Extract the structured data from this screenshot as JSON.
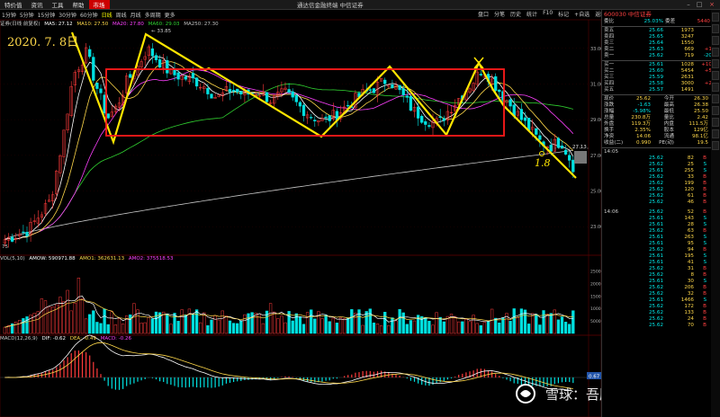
{
  "menubar": {
    "items": [
      "特价值",
      "资讯",
      "工具",
      "帮助",
      "市场"
    ],
    "title": "通达信金融终端 中信证券"
  },
  "toolbar": {
    "periods": [
      "1分钟",
      "5分钟",
      "15分钟",
      "30分钟",
      "60分钟",
      "日线",
      "周线",
      "月线",
      "多周期",
      "更多"
    ],
    "selected": "日线",
    "right": [
      "盘口",
      "分笔",
      "历史",
      "统计",
      "F10",
      "标记",
      "+自选",
      "返回"
    ]
  },
  "ma_legend": {
    "label": "证券(日线 前复权)",
    "items": [
      {
        "text": "MA5: 27.12",
        "color": "#ffffff"
      },
      {
        "text": "MA10: 27.50",
        "color": "#ffd84a"
      },
      {
        "text": "MA20: 27.80",
        "color": "#ff40ff"
      },
      {
        "text": "MA60: 29.03",
        "color": "#30d030"
      },
      {
        "text": "MA250: 27.30",
        "color": "#c0c0c0"
      }
    ]
  },
  "annotation": {
    "date": "2020. 7. 8日",
    "mark": "1.8"
  },
  "price_axis": {
    "labels": [
      "33.00",
      "31.00",
      "29.00",
      "27.00",
      "25.00",
      "23.00"
    ],
    "high_label": "33.85",
    "low_label": "75",
    "current_label": "27.13"
  },
  "volume_legend": {
    "label": "VOL(5,10)",
    "items": [
      {
        "text": "AMOW: 590971.88",
        "color": "#ffffff"
      },
      {
        "text": "AMO1: 362631.13",
        "color": "#ffd84a"
      },
      {
        "text": "AMO2: 375518.53",
        "color": "#ff40ff"
      }
    ],
    "axis": [
      "25000",
      "20000",
      "15000",
      "10000",
      "5000"
    ]
  },
  "macd_legend": {
    "label": "MACD(12,26,9)",
    "items": [
      {
        "text": "DIF: -0.62",
        "color": "#ffffff"
      },
      {
        "text": "DEA: -0.49",
        "color": "#ffd84a"
      },
      {
        "text": "MACD: -0.26",
        "color": "#ff40ff"
      }
    ],
    "value_box": "0.67"
  },
  "watermark": "雪球：吾股能手V",
  "panel": {
    "code": "600030",
    "name": "中信证券",
    "weibi": {
      "label": "委比",
      "value": "25.03%",
      "label2": "委差",
      "value2": "5440"
    },
    "asks": [
      {
        "label": "卖五",
        "price": "25.66",
        "vol": "1973",
        "chg": ""
      },
      {
        "label": "卖四",
        "price": "25.65",
        "vol": "3247",
        "chg": ""
      },
      {
        "label": "卖三",
        "price": "25.64",
        "vol": "1550",
        "chg": ""
      },
      {
        "label": "卖二",
        "price": "25.63",
        "vol": "669",
        "chg": "+1"
      },
      {
        "label": "卖一",
        "price": "25.62",
        "vol": "719",
        "chg": "-20"
      }
    ],
    "bids": [
      {
        "label": "买一",
        "price": "25.61",
        "vol": "1028",
        "chg": "+10"
      },
      {
        "label": "买二",
        "price": "25.60",
        "vol": "5454",
        "chg": "+5"
      },
      {
        "label": "买三",
        "price": "25.59",
        "vol": "2631",
        "chg": ""
      },
      {
        "label": "买四",
        "price": "25.58",
        "vol": "3000",
        "chg": "+2"
      },
      {
        "label": "买五",
        "price": "25.57",
        "vol": "1491",
        "chg": ""
      }
    ],
    "quote": [
      {
        "l1": "现价",
        "v1": "25.62",
        "l2": "今开",
        "v2": "26.30"
      },
      {
        "l1": "涨跌",
        "v1": "-1.63",
        "l2": "最高",
        "v2": "26.38"
      },
      {
        "l1": "涨幅",
        "v1": "-5.98%",
        "l2": "最低",
        "v2": "25.50"
      },
      {
        "l1": "总量",
        "v1": "230.8万",
        "l2": "量比",
        "v2": "2.42"
      },
      {
        "l1": "外盘",
        "v1": "119.3万",
        "l2": "内盘",
        "v2": "111.5万"
      },
      {
        "l1": "换手",
        "v1": "2.35%",
        "l2": "股本",
        "v2": "129亿"
      },
      {
        "l1": "净资",
        "v1": "14.06",
        "l2": "流通",
        "v2": "98.1亿"
      },
      {
        "l1": "收益(二)",
        "v1": "0.990",
        "l2": "PE(动)",
        "v2": "19.5"
      }
    ],
    "ticks1": [
      {
        "t": "14:05",
        "p": "",
        "v": "",
        "s": ""
      },
      {
        "t": "",
        "p": "25.62",
        "v": "82",
        "s": "B"
      },
      {
        "t": "",
        "p": "25.62",
        "v": "25",
        "s": "S"
      },
      {
        "t": "",
        "p": "25.61",
        "v": "255",
        "s": "S"
      },
      {
        "t": "",
        "p": "25.62",
        "v": "33",
        "s": "B"
      },
      {
        "t": "",
        "p": "25.62",
        "v": "199",
        "s": "B"
      },
      {
        "t": "",
        "p": "25.62",
        "v": "120",
        "s": "B"
      },
      {
        "t": "",
        "p": "25.62",
        "v": "61",
        "s": "B"
      },
      {
        "t": "",
        "p": "25.62",
        "v": "46",
        "s": "B"
      }
    ],
    "ticks2": [
      {
        "t": "14:06",
        "p": "25.62",
        "v": "52",
        "s": "B"
      },
      {
        "t": "",
        "p": "25.61",
        "v": "143",
        "s": "S"
      },
      {
        "t": "",
        "p": "25.61",
        "v": "28",
        "s": "S"
      },
      {
        "t": "",
        "p": "25.62",
        "v": "63",
        "s": "B"
      },
      {
        "t": "",
        "p": "25.61",
        "v": "263",
        "s": "S"
      },
      {
        "t": "",
        "p": "25.61",
        "v": "95",
        "s": "S"
      },
      {
        "t": "",
        "p": "25.62",
        "v": "94",
        "s": "B"
      },
      {
        "t": "",
        "p": "25.61",
        "v": "195",
        "s": "S"
      },
      {
        "t": "",
        "p": "25.61",
        "v": "41",
        "s": "S"
      },
      {
        "t": "",
        "p": "25.62",
        "v": "31",
        "s": "B"
      },
      {
        "t": "",
        "p": "25.62",
        "v": "8",
        "s": "B"
      },
      {
        "t": "",
        "p": "25.61",
        "v": "30",
        "s": "S"
      },
      {
        "t": "",
        "p": "25.62",
        "v": "206",
        "s": "B"
      },
      {
        "t": "",
        "p": "25.62",
        "v": "32",
        "s": "B"
      },
      {
        "t": "",
        "p": "25.61",
        "v": "1466",
        "s": "S"
      },
      {
        "t": "",
        "p": "25.62",
        "v": "172",
        "s": "B"
      },
      {
        "t": "",
        "p": "25.62",
        "v": "133",
        "s": "B"
      },
      {
        "t": "",
        "p": "25.62",
        "v": "24",
        "s": "B"
      },
      {
        "t": "",
        "p": "25.62",
        "v": "70",
        "s": "B"
      }
    ]
  }
}
